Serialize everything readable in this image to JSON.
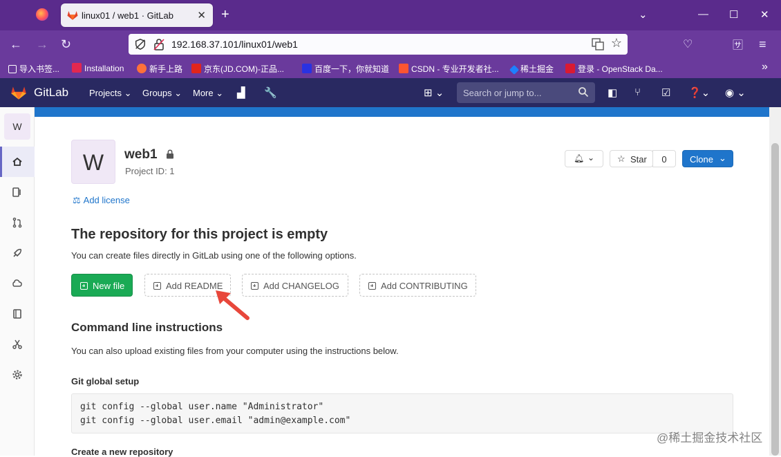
{
  "browser": {
    "tab_title": "linux01 / web1 · GitLab",
    "url": "192.168.37.101/linux01/web1",
    "bookmarks": [
      "导入书签...",
      "Installation",
      "新手上路",
      "京东(JD.COM)-正品...",
      "百度一下，你就知道",
      "CSDN - 专业开发者社...",
      "稀土掘金",
      "登录 - OpenStack Da..."
    ]
  },
  "gitlab_nav": {
    "brand": "GitLab",
    "menus": [
      "Projects",
      "Groups",
      "More"
    ],
    "search_placeholder": "Search or jump to..."
  },
  "sidebar": {
    "project_initial": "W"
  },
  "project": {
    "initial": "W",
    "name": "web1",
    "id_text": "Project ID: 1",
    "star_label": "Star",
    "star_count": "0",
    "clone_label": "Clone",
    "add_license": "Add license"
  },
  "empty_repo": {
    "heading": "The repository for this project is empty",
    "description": "You can create files directly in GitLab using one of the following options.",
    "new_file": "New file",
    "add_readme": "Add README",
    "add_changelog": "Add CHANGELOG",
    "add_contributing": "Add CONTRIBUTING"
  },
  "cli": {
    "heading": "Command line instructions",
    "description": "You can also upload existing files from your computer using the instructions below.",
    "git_global_setup": "Git global setup",
    "code": "git config --global user.name \"Administrator\"\ngit config --global user.email \"admin@example.com\"",
    "create_repo": "Create a new repository"
  },
  "watermark": "@稀土掘金技术社区",
  "colors": {
    "gitlab_nav": "#292961",
    "primary": "#1f75cb",
    "success": "#1aaa55",
    "browser_chrome": "#6a3a9c"
  }
}
